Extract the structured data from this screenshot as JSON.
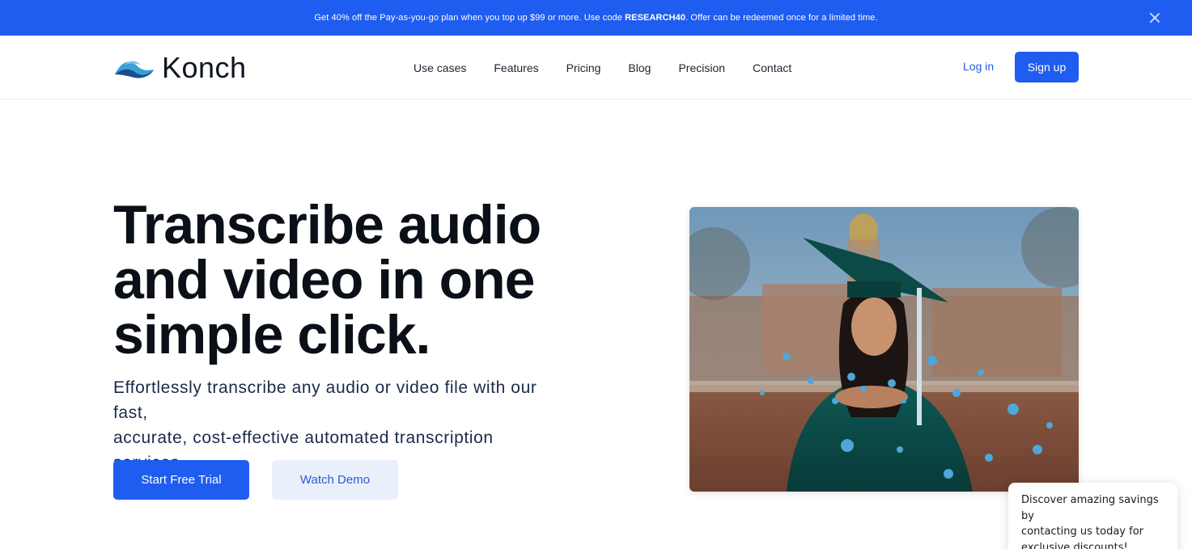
{
  "promo": {
    "text_before": "Get 40% off the Pay-as-you-go plan when you top up $99 or more. Use code ",
    "code": "RESEARCH40",
    "text_after": ". Offer can be redeemed once for a limited time.",
    "close_icon": "close-icon"
  },
  "header": {
    "logo_text": "Konch",
    "logo_icon": "wave-logo-icon",
    "nav": [
      "Use cases",
      "Features",
      "Pricing",
      "Blog",
      "Precision",
      "Contact"
    ],
    "login": "Log in",
    "signup": "Sign up"
  },
  "hero": {
    "title_lines": [
      "Transcribe audio",
      "and video in one",
      "simple click."
    ],
    "subtitle_lines": [
      "Effortlessly transcribe any audio or video file with our fast,",
      "accurate, cost-effective automated transcription services."
    ],
    "primary_button": "Start Free Trial",
    "secondary_button": "Watch Demo",
    "image_alt": "graduate-blowing-confetti-photo"
  },
  "chat_popup": {
    "lines": [
      "Discover amazing savings by",
      "contacting us today for",
      "exclusive discounts!"
    ]
  },
  "colors": {
    "brand_blue": "#1f5cf0",
    "secondary_button_bg": "#eaf0fb",
    "text_dark": "#0a0f18"
  }
}
